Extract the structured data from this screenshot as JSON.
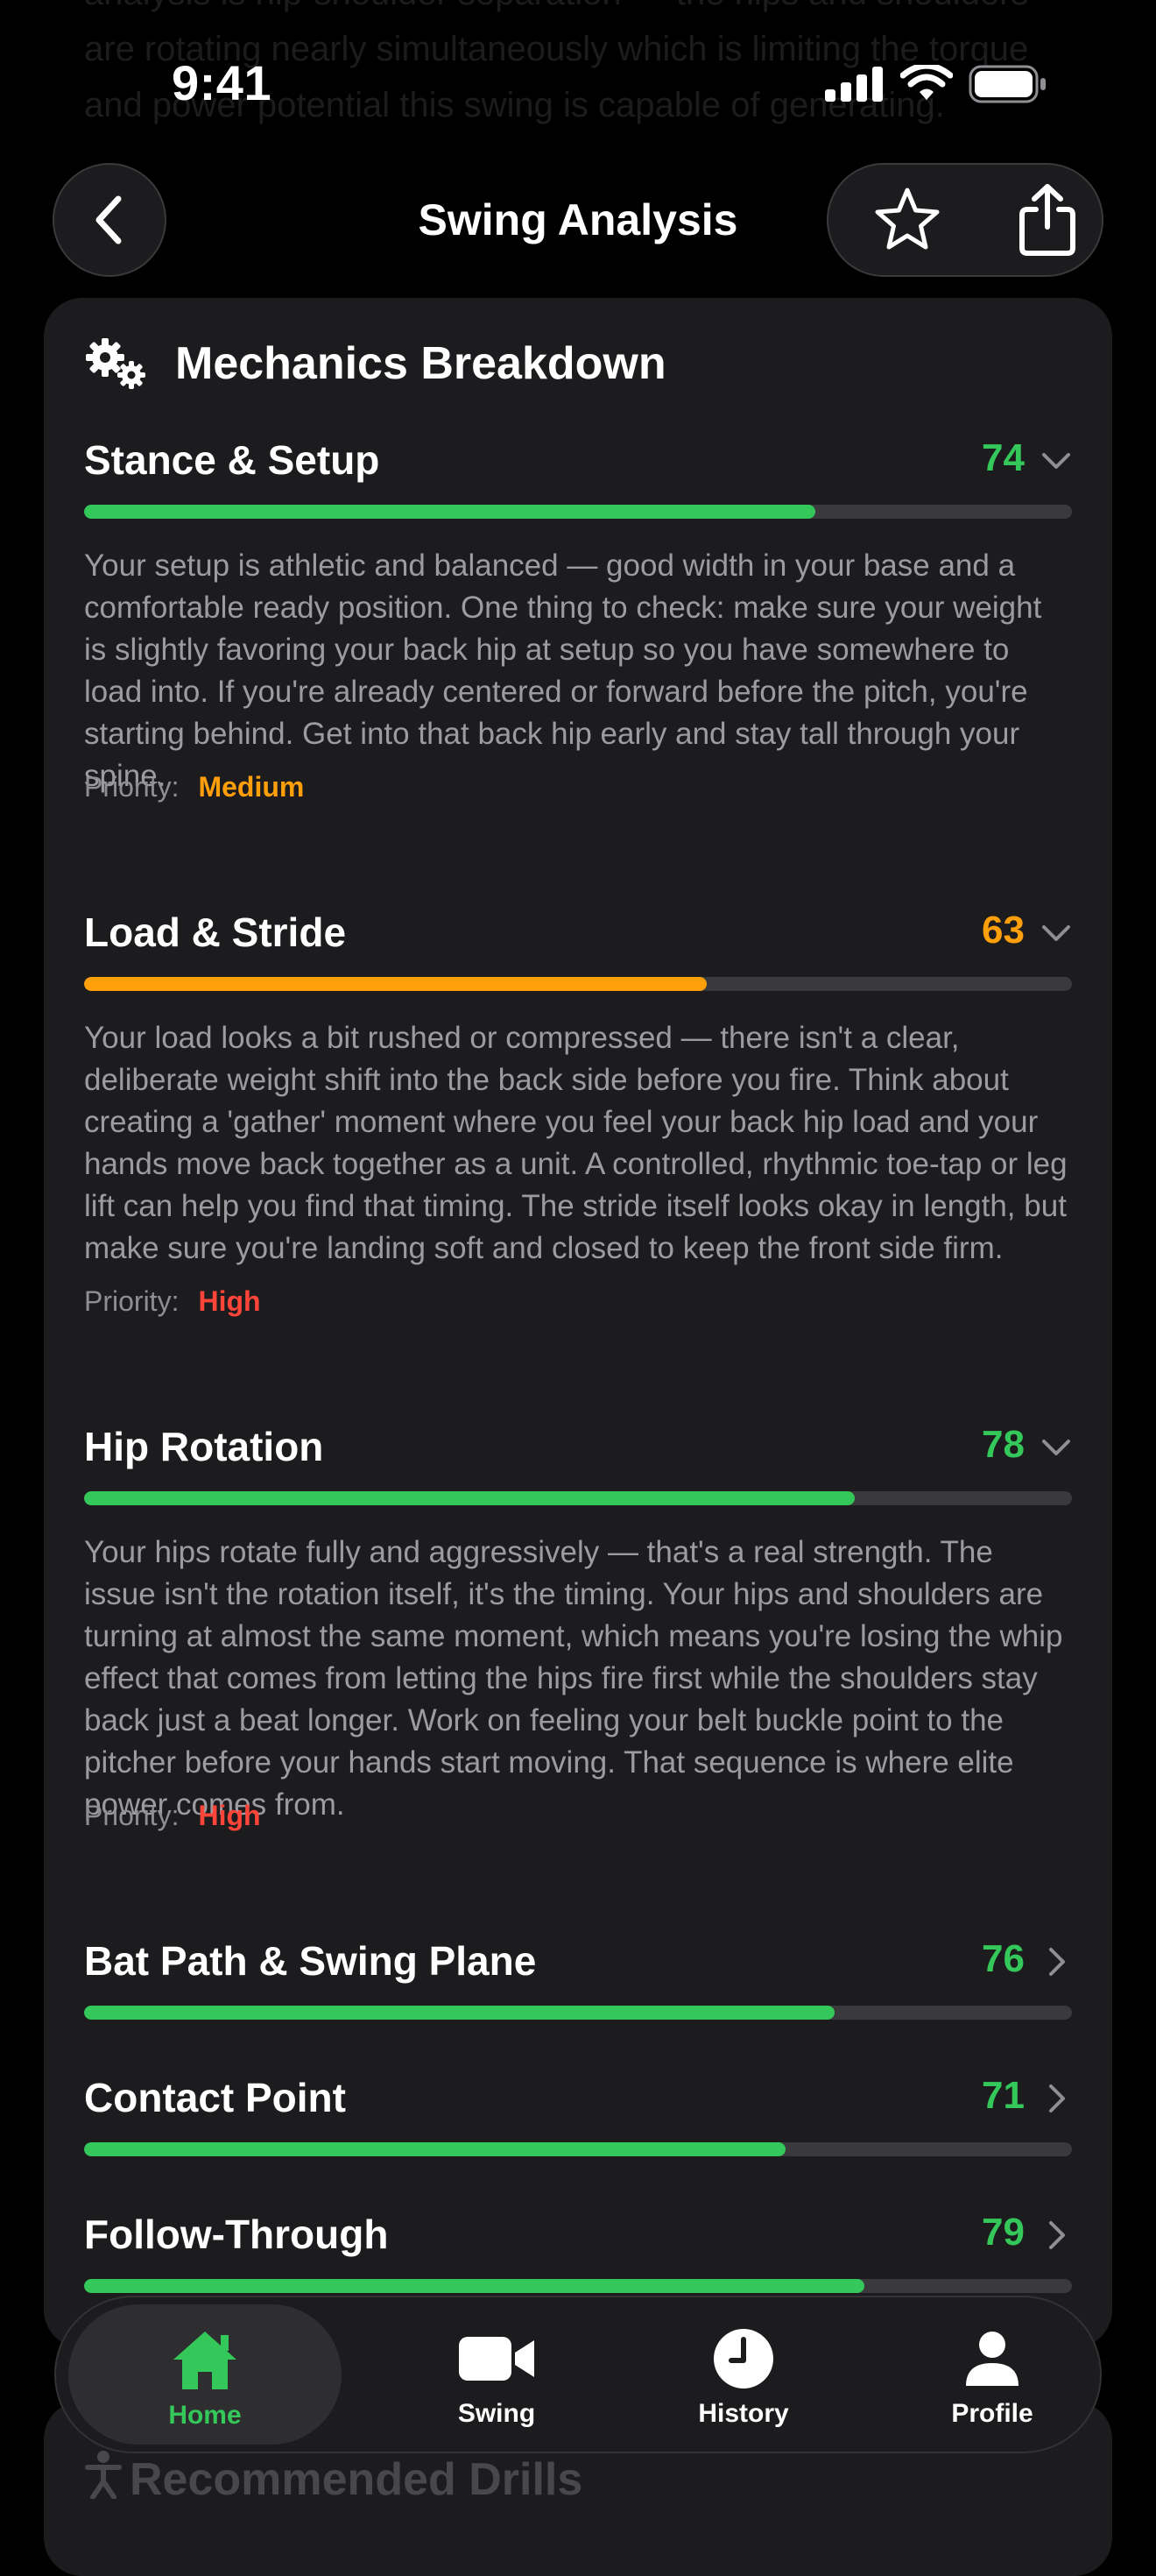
{
  "background_text": "analysis is hip-shoulder separation — the hips and shoulders are rotating nearly simultaneously which is limiting the torque and power potential this swing is capable of generating.",
  "status": {
    "time": "9:41"
  },
  "nav": {
    "title": "Swing Analysis",
    "back_icon": "chevron-left-icon",
    "favorite_icon": "star-icon",
    "share_icon": "share-icon"
  },
  "card": {
    "title": "Mechanics Breakdown",
    "icon": "gears-icon",
    "sections": [
      {
        "title": "Stance & Setup",
        "score": "74",
        "progress": 0.74,
        "color": "#34c759",
        "expanded": true,
        "description": "Your setup is athletic and balanced — good width in your base and a comfortable ready position. One thing to check: make sure your weight is slightly favoring your back hip at setup so you have somewhere to load into. If you're already centered or forward before the pitch, you're starting behind. Get into that back hip early and stay tall through your spine.",
        "priority_label": "Priority:",
        "priority": "Medium",
        "priority_color": "#ff9f0a"
      },
      {
        "title": "Load & Stride",
        "score": "63",
        "progress": 0.63,
        "color": "#ff9f0a",
        "expanded": true,
        "description": "Your load looks a bit rushed or compressed — there isn't a clear, deliberate weight shift into the back side before you fire. Think about creating a 'gather' moment where you feel your back hip load and your hands move back together as a unit. A controlled, rhythmic toe-tap or leg lift can help you find that timing. The stride itself looks okay in length, but make sure you're landing soft and closed to keep the front side firm.",
        "priority_label": "Priority:",
        "priority": "High",
        "priority_color": "#ff453a"
      },
      {
        "title": "Hip Rotation",
        "score": "78",
        "progress": 0.78,
        "color": "#34c759",
        "expanded": true,
        "description": "Your hips rotate fully and aggressively — that's a real strength. The issue isn't the rotation itself, it's the timing. Your hips and shoulders are turning at almost the same moment, which means you're losing the whip effect that comes from letting the hips fire first while the shoulders stay back just a beat longer. Work on feeling your belt buckle point to the pitcher before your hands start moving. That sequence is where elite power comes from.",
        "priority_label": "Priority:",
        "priority": "High",
        "priority_color": "#ff453a"
      },
      {
        "title": "Bat Path & Swing Plane",
        "score": "76",
        "progress": 0.76,
        "color": "#34c759",
        "expanded": false
      },
      {
        "title": "Contact Point",
        "score": "71",
        "progress": 0.71,
        "color": "#34c759",
        "expanded": false
      },
      {
        "title": "Follow-Through",
        "score": "79",
        "progress": 0.79,
        "color": "#34c759",
        "expanded": false
      }
    ]
  },
  "next_section_title": "Recommended Drills",
  "tabs": [
    {
      "label": "Home",
      "icon": "home-icon",
      "active": true
    },
    {
      "label": "Swing",
      "icon": "video-camera-icon",
      "active": false
    },
    {
      "label": "History",
      "icon": "clock-icon",
      "active": false
    },
    {
      "label": "Profile",
      "icon": "person-icon",
      "active": false
    }
  ]
}
